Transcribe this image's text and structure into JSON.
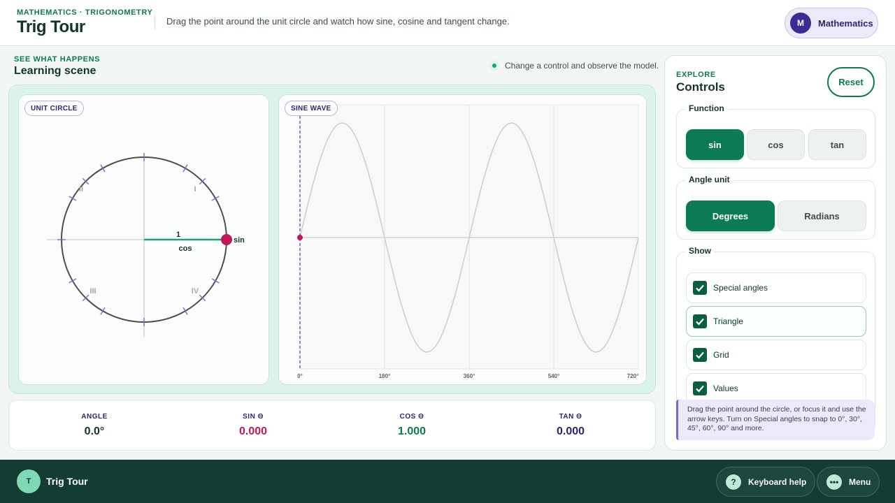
{
  "header": {
    "eyebrow": "MATHEMATICS · TRIGONOMETRY",
    "title": "Trig Tour",
    "tagline": "Drag the point around the unit circle and watch how sine, cosine and tangent change.",
    "subject": {
      "initial": "M",
      "label": "Mathematics"
    }
  },
  "scene": {
    "eyebrow": "SEE WHAT HAPPENS",
    "title": "Learning scene",
    "hint": "Change a control and observe the model."
  },
  "unit_circle": {
    "tag": "UNIT CIRCLE",
    "quadrants": [
      "I",
      "II",
      "III",
      "IV"
    ],
    "radius_label": "1",
    "cos_label": "cos",
    "sin_label": "sin",
    "angle_deg": 0,
    "colors": {
      "circle": "#4a4f4c",
      "cos": "#18a56f",
      "point": "#c2185b",
      "tick": "#7b6ad8"
    }
  },
  "sine_wave": {
    "tag": "SINE WAVE",
    "x_ticks": [
      "0°",
      "180°",
      "360°",
      "540°",
      "720°"
    ],
    "colors": {
      "curve": "#c8cfcc",
      "cursor": "#4a3b9c",
      "point": "#c2185b"
    }
  },
  "readouts": [
    {
      "label": "ANGLE",
      "value": "0.0°",
      "color": "#10352b"
    },
    {
      "label": "SIN Θ",
      "value": "0.000",
      "color": "#c2185b"
    },
    {
      "label": "COS Θ",
      "value": "1.000",
      "color": "#0b7a55"
    },
    {
      "label": "TAN Θ",
      "value": "0.000",
      "color": "#2e2574"
    }
  ],
  "controls": {
    "eyebrow": "EXPLORE",
    "title": "Controls",
    "reset_label": "Reset",
    "function": {
      "legend": "Function",
      "options": [
        "sin",
        "cos",
        "tan"
      ],
      "selected": "sin"
    },
    "angle_unit": {
      "legend": "Angle unit",
      "options": [
        "Degrees",
        "Radians"
      ],
      "selected": "Degrees"
    },
    "show": {
      "legend": "Show",
      "items": [
        {
          "label": "Special angles",
          "checked": true
        },
        {
          "label": "Triangle",
          "checked": true
        },
        {
          "label": "Grid",
          "checked": true
        },
        {
          "label": "Values",
          "checked": true
        }
      ]
    },
    "help": "Drag the point around the circle, or focus it and use the arrow keys. Turn on Special angles to snap to 0°, 30°, 45°, 60°, 90° and more."
  },
  "footer": {
    "initial": "T",
    "title": "Trig Tour",
    "keyboard_help": "Keyboard help",
    "keyboard_icon": "question-icon",
    "menu": "Menu",
    "menu_icon": "more-dots-icon"
  }
}
